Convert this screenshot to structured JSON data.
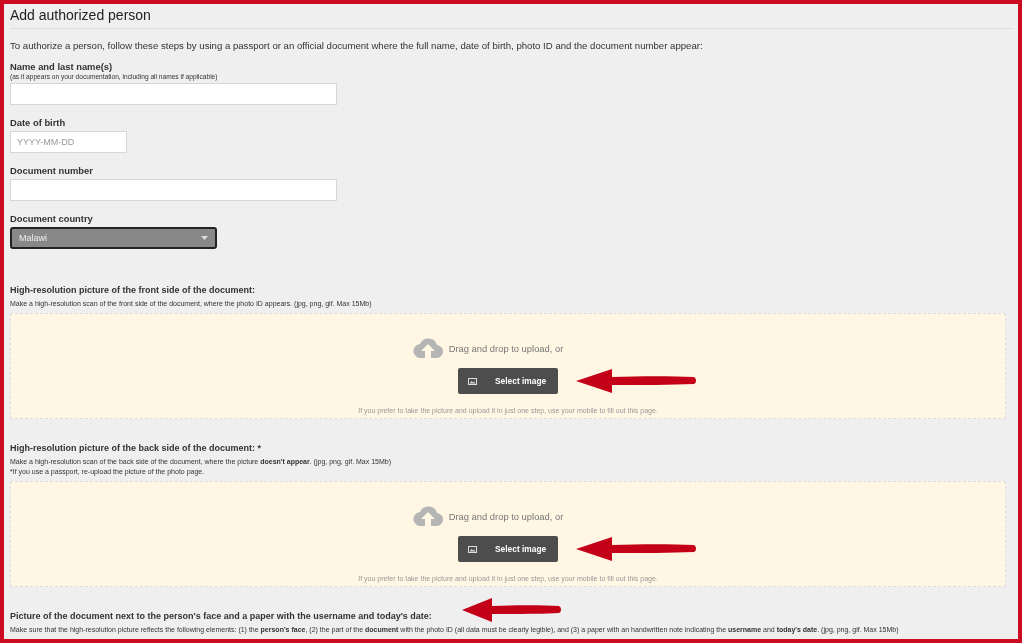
{
  "title": "Add authorized person",
  "intro": "To authorize a person, follow these steps by using a passport or an official document where the full name, date of birth, photo ID and the document number appear:",
  "fields": [
    {
      "kind": "text",
      "label": "Name and last name(s)",
      "hint": "(as it appears on your documentation, including all names if applicable)"
    },
    {
      "kind": "date",
      "label": "Date of birth",
      "placeholder": "YYYY-MM-DD"
    },
    {
      "kind": "text",
      "label": "Document number"
    },
    {
      "kind": "select",
      "label": "Document country",
      "value": "Malawi"
    }
  ],
  "uploads": [
    {
      "heading": "High-resolution picture of the front side of the document:",
      "notes": [
        "Make a high-resolution scan of the front side of the document, where the photo ID appears. (jpg, png, gif. Max 15Mb)"
      ],
      "drop_text": "Drag and drop to upload, or",
      "button": "Select image",
      "tip": "If you prefer to take the picture and upload it in just one step, use your mobile to fill out this page."
    },
    {
      "heading": "High-resolution picture of the back side of the document: *",
      "notes": [
        "Make a high-resolution scan of the back side of the document, where the picture **doesn't appear**. (jpg, png, gif. Max 15Mb)",
        "*If you use a passport, re-upload the picture of the photo page."
      ],
      "drop_text": "Drag and drop to upload, or",
      "button": "Select image",
      "tip": "If you prefer to take the picture and upload it in just one step, use your mobile to fill out this page."
    },
    {
      "heading": "Picture of the document next to the person's face and a paper with the username and today's date:",
      "notes": [
        "Make sure that the high-resolution picture reflects the following elements: (1) the **person's face**, (2) the part of the **document** with the photo ID (all data must be clearly legible), and (3) a paper with an handwritten note indicating the **username** and **today's date**. (jpg, png, gif. Max 15Mb)"
      ]
    }
  ]
}
